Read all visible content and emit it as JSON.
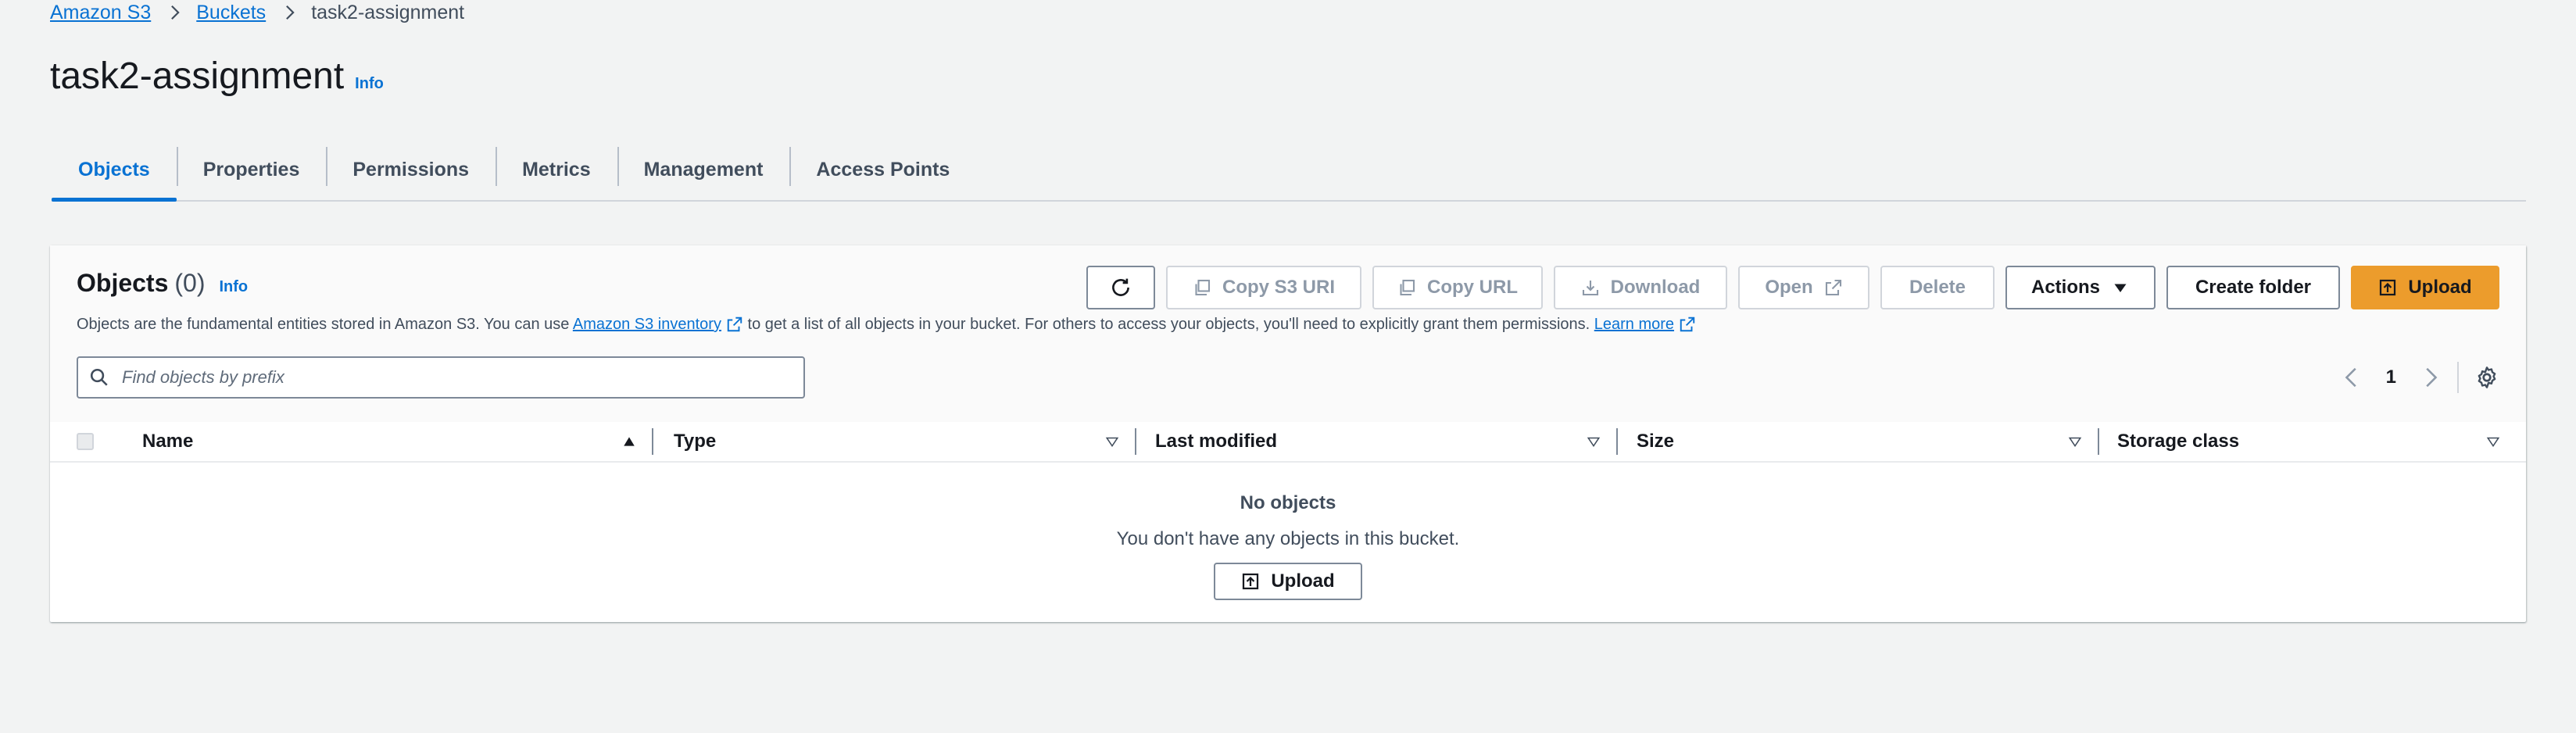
{
  "breadcrumb": {
    "items": [
      "Amazon S3",
      "Buckets"
    ],
    "current": "task2-assignment"
  },
  "header": {
    "title": "task2-assignment",
    "info": "Info"
  },
  "tabs": [
    "Objects",
    "Properties",
    "Permissions",
    "Metrics",
    "Management",
    "Access Points"
  ],
  "active_tab": "Objects",
  "objects_panel": {
    "title": "Objects",
    "count": "(0)",
    "info": "Info",
    "desc_before": "Objects are the fundamental entities stored in Amazon S3. You can use",
    "desc_link": "Amazon S3 inventory",
    "desc_after": "to get a list of all objects in your bucket. For others to access your objects, you'll need to explicitly grant them permissions.",
    "learn_more": "Learn more"
  },
  "toolbar": {
    "copy_s3_uri": "Copy S3 URI",
    "copy_url": "Copy URL",
    "download": "Download",
    "open": "Open",
    "delete": "Delete",
    "actions": "Actions",
    "create_folder": "Create folder",
    "upload": "Upload"
  },
  "search": {
    "placeholder": "Find objects by prefix"
  },
  "pagination": {
    "page": "1"
  },
  "table": {
    "columns": [
      "Name",
      "Type",
      "Last modified",
      "Size",
      "Storage class"
    ]
  },
  "empty_state": {
    "title": "No objects",
    "message": "You don't have any objects in this bucket.",
    "upload": "Upload"
  },
  "colors": {
    "link": "#0972d3",
    "primary_button": "#ec9c2c",
    "background": "#f2f3f3"
  }
}
